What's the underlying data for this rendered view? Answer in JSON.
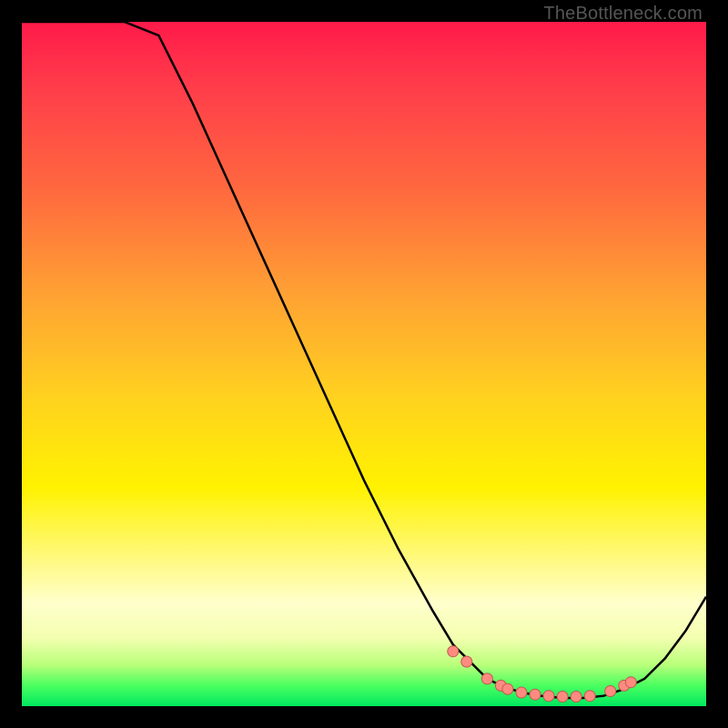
{
  "watermark": "TheBottleneck.com",
  "colors": {
    "curve": "#000000",
    "marker_fill": "#ff8a80",
    "marker_stroke": "#c05a50"
  },
  "chart_data": {
    "type": "line",
    "title": "",
    "xlabel": "",
    "ylabel": "",
    "xlim": [
      0,
      100
    ],
    "ylim": [
      0,
      100
    ],
    "grid": false,
    "series": [
      {
        "name": "bottleneck-curve",
        "x": [
          0,
          5,
          10,
          15,
          20,
          25,
          30,
          35,
          40,
          45,
          50,
          55,
          60,
          63,
          66,
          68,
          70,
          73,
          76,
          79,
          82,
          85,
          88,
          91,
          94,
          97,
          100
        ],
        "y": [
          100,
          100,
          100,
          100,
          98,
          88,
          77,
          66,
          55,
          44,
          33,
          23,
          14,
          9,
          6,
          4,
          3,
          2,
          1.5,
          1.2,
          1.2,
          1.5,
          2.5,
          4,
          7,
          11,
          16
        ]
      }
    ],
    "markers": {
      "name": "highlight-points",
      "x": [
        63,
        65,
        68,
        70,
        71,
        73,
        75,
        77,
        79,
        81,
        83,
        86,
        88,
        89
      ],
      "y": [
        8,
        6.5,
        4,
        3,
        2.5,
        2,
        1.7,
        1.5,
        1.4,
        1.4,
        1.5,
        2.2,
        3,
        3.5
      ]
    }
  }
}
